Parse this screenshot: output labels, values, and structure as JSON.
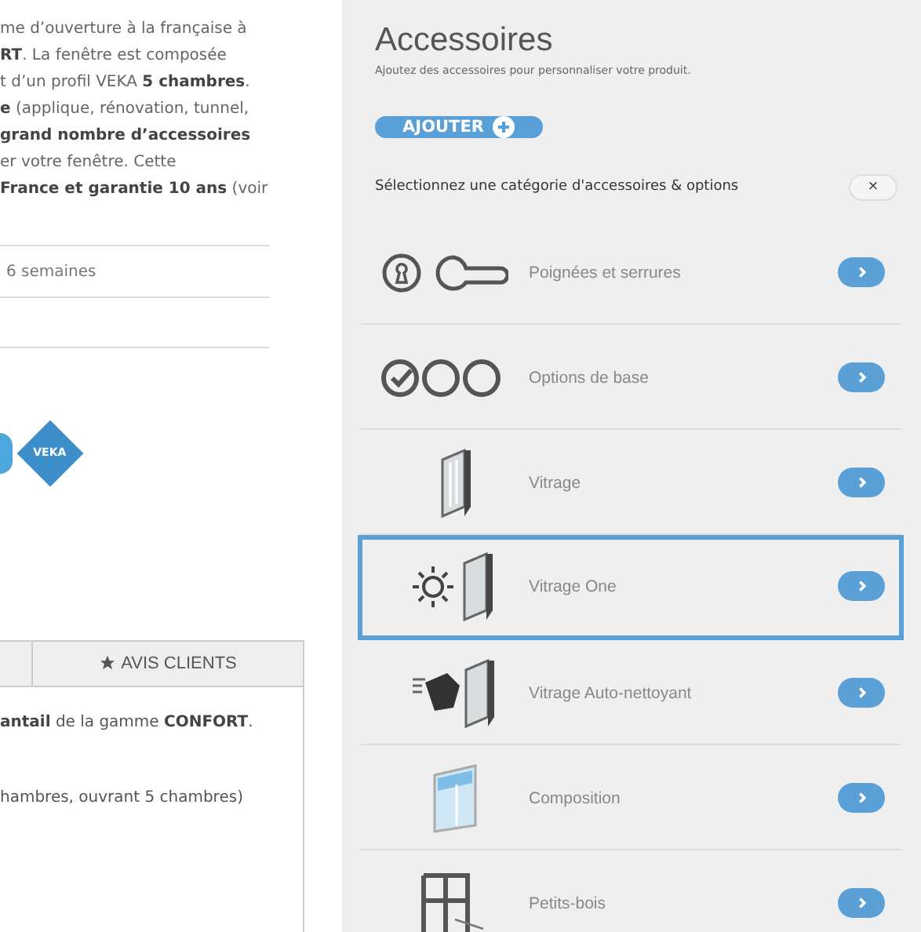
{
  "description": {
    "lines": [
      "me d’ouverture à la française à",
      "**RT**. La fenêtre est composée",
      "t d’un profil VEKA **5 chambres**.",
      "**e** (applique, rénovation, tunnel,",
      "**grand nombre d’accessoires**",
      "er votre fenêtre. Cette",
      "**France et garantie 10 ans** (voir"
    ]
  },
  "info_rows": [
    "6 semaines"
  ],
  "logos": {
    "veka": "VEKA"
  },
  "tabs": [
    {
      "selected": false
    },
    {
      "label": "AVIS CLIENTS",
      "selected": false
    }
  ],
  "tab_content": {
    "lines": [
      "**antail** de la gamme **CONFORT**.",
      "hambres, ouvrant 5 chambres)"
    ]
  },
  "accessories": {
    "title": "Accessoires",
    "subtitle": "Ajoutez des accessoires pour personnaliser votre produit.",
    "add_button": "AJOUTER",
    "prompt": "Sélectionnez une catégorie d'accessoires & options",
    "close": "×",
    "categories": [
      {
        "label": "Poignées et serrures",
        "selected": false
      },
      {
        "label": "Options de base",
        "selected": false
      },
      {
        "label": "Vitrage",
        "selected": false
      },
      {
        "label": "Vitrage One",
        "selected": true
      },
      {
        "label": "Vitrage Auto-nettoyant",
        "selected": false
      },
      {
        "label": "Composition",
        "selected": false
      },
      {
        "label": "Petits-bois",
        "selected": false
      }
    ]
  }
}
